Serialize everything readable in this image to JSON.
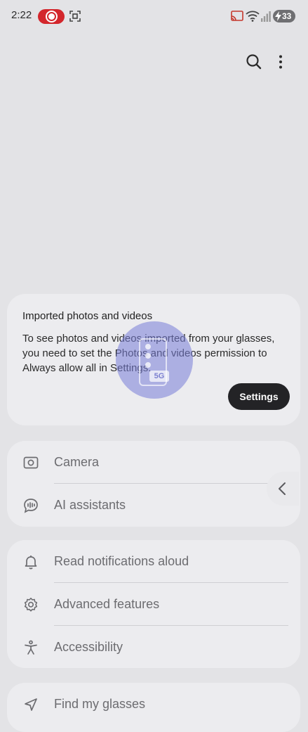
{
  "status_bar": {
    "time": "2:22",
    "battery_level": "33",
    "icons": [
      "screen-record-icon",
      "screenshot-icon",
      "cast-icon",
      "wifi-icon",
      "signal-icon",
      "battery-icon"
    ]
  },
  "toolbar": {
    "icons": [
      "search-icon",
      "more-vert-icon"
    ]
  },
  "import_card": {
    "title": "Imported photos and videos",
    "text": "To see photos and videos imported from your glasses, you need to set the Photos and videos permission to Always allow all in Settings.",
    "button_label": "Settings"
  },
  "overlay": {
    "tag": "5G"
  },
  "groups": [
    {
      "items": [
        {
          "label": "Camera",
          "icon": "camera-icon"
        },
        {
          "label": "AI assistants",
          "icon": "ai-assistant-icon"
        }
      ]
    },
    {
      "items": [
        {
          "label": "Read notifications aloud",
          "icon": "bell-icon"
        },
        {
          "label": "Advanced features",
          "icon": "gear-icon"
        },
        {
          "label": "Accessibility",
          "icon": "accessibility-icon"
        }
      ]
    },
    {
      "items": [
        {
          "label": "Find my glasses",
          "icon": "location-arrow-icon"
        }
      ]
    }
  ],
  "colors": {
    "background": "#e3e3e6",
    "card": "#ececef",
    "record_red": "#d3262c",
    "button_dark": "#232326"
  }
}
